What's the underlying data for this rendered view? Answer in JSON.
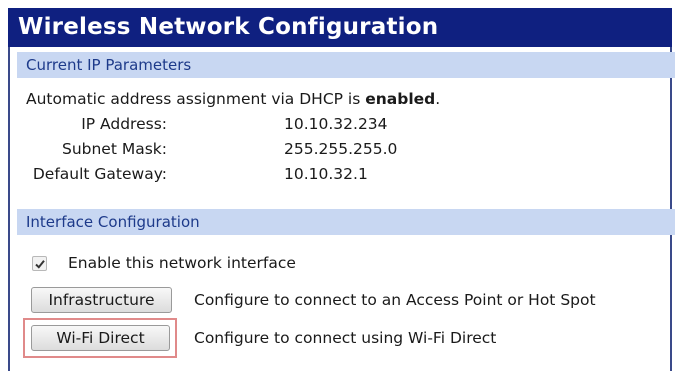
{
  "title": "Wireless Network Configuration",
  "ip_section": {
    "header": "Current IP Parameters",
    "dhcp_prefix": "Automatic address assignment via DHCP is ",
    "dhcp_status": "enabled",
    "dhcp_suffix": ".",
    "params": [
      {
        "label": "IP Address:",
        "value": "10.10.32.234"
      },
      {
        "label": "Subnet Mask:",
        "value": "255.255.255.0"
      },
      {
        "label": "Default Gateway:",
        "value": "10.10.32.1"
      }
    ]
  },
  "interface_section": {
    "header": "Interface Configuration",
    "enable_label": "Enable this network interface",
    "enable_checked": true,
    "buttons": [
      {
        "label": "Infrastructure",
        "description": "Configure to connect to an Access Point or Hot Spot"
      },
      {
        "label": "Wi-Fi Direct",
        "description": "Configure to connect using Wi-Fi Direct"
      }
    ]
  },
  "colors": {
    "title_bg": "#0f2080",
    "section_bg": "#c8d7f2",
    "section_text": "#1d3a8a",
    "highlight_border": "#e08a8a"
  },
  "icons": {
    "checkbox": "checkmark-icon"
  }
}
